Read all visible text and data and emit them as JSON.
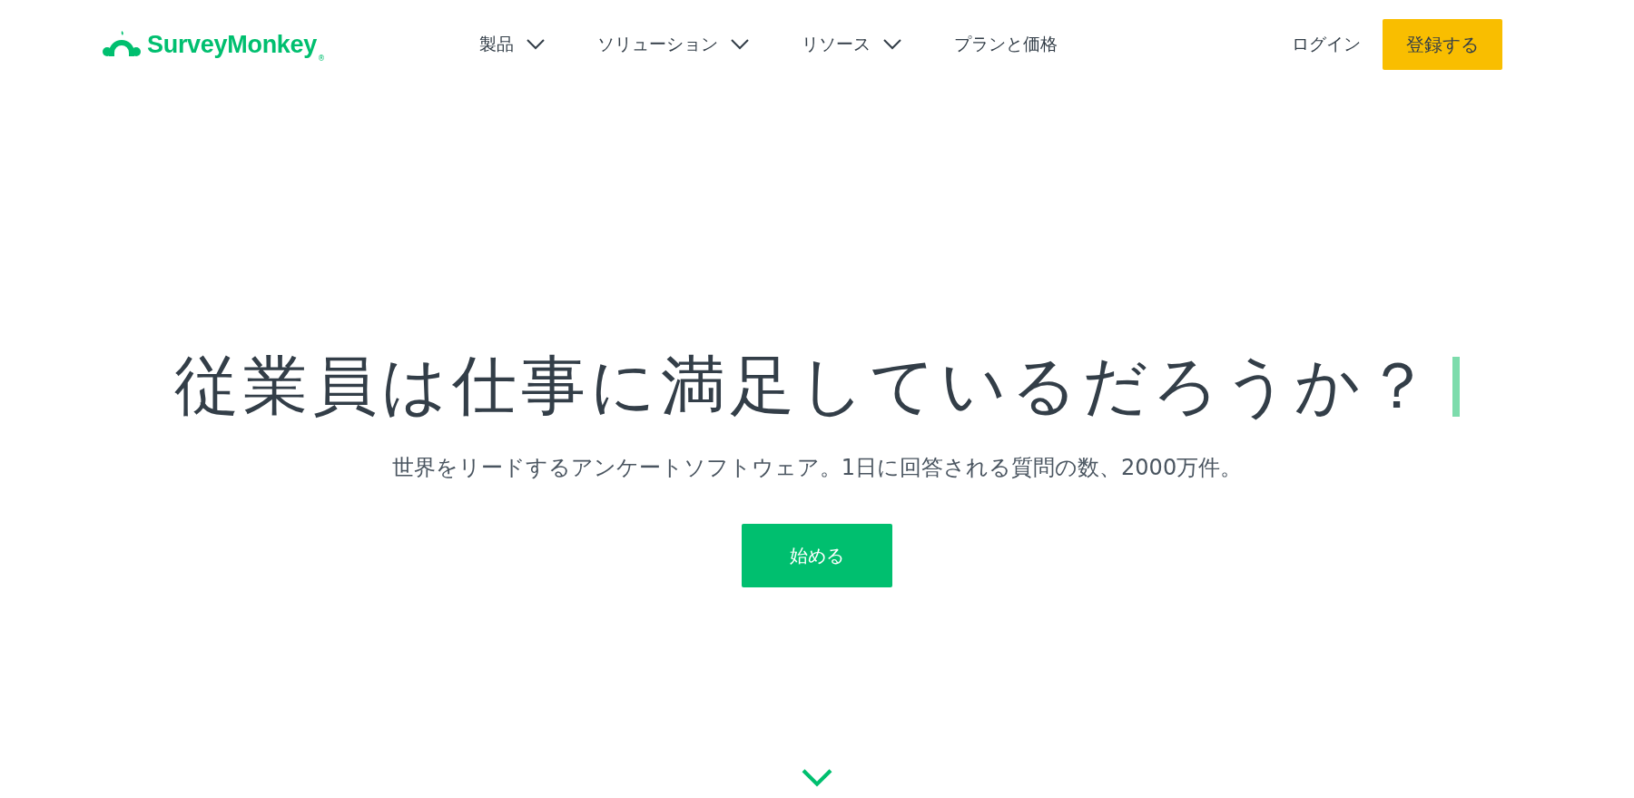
{
  "header": {
    "logo": {
      "name": "SurveyMonkey",
      "mark": "®"
    },
    "nav": [
      {
        "label": "製品",
        "dropdown": true
      },
      {
        "label": "ソリューション",
        "dropdown": true
      },
      {
        "label": "リソース",
        "dropdown": true
      },
      {
        "label": "プランと価格",
        "dropdown": false
      }
    ],
    "login": "ログイン",
    "signup": "登録する"
  },
  "hero": {
    "headline": "従業員は仕事に満足しているだろうか？",
    "subtitle": "世界をリードするアンケートソフトウェア。1日に回答される質問の数、2000万件。",
    "cta": "始める"
  }
}
